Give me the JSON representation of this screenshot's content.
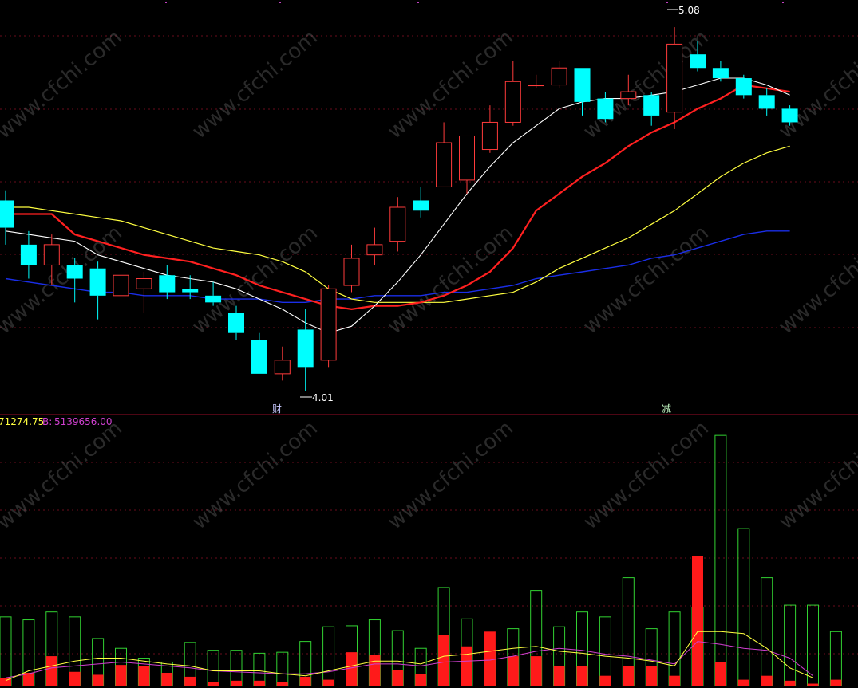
{
  "chart_data": [
    {
      "type": "candlestick",
      "panel": "price",
      "grid": true,
      "colors": {
        "up": "#ff3b3b",
        "down": "#00ffff",
        "ma5": "#ffffff",
        "ma10": "#ff2020",
        "ma20": "#ffff40",
        "ma60": "#1a2ee8",
        "bg": "#000000",
        "grid": "#6a0b1d"
      },
      "candles": [
        {
          "o": 4.57,
          "h": 4.6,
          "l": 4.44,
          "c": 4.49
        },
        {
          "o": 4.44,
          "h": 4.48,
          "l": 4.34,
          "c": 4.38
        },
        {
          "o": 4.38,
          "h": 4.47,
          "l": 4.32,
          "c": 4.44
        },
        {
          "o": 4.38,
          "h": 4.4,
          "l": 4.27,
          "c": 4.34
        },
        {
          "o": 4.37,
          "h": 4.39,
          "l": 4.22,
          "c": 4.29
        },
        {
          "o": 4.29,
          "h": 4.37,
          "l": 4.25,
          "c": 4.35
        },
        {
          "o": 4.31,
          "h": 4.36,
          "l": 4.24,
          "c": 4.34
        },
        {
          "o": 4.35,
          "h": 4.38,
          "l": 4.28,
          "c": 4.3
        },
        {
          "o": 4.31,
          "h": 4.35,
          "l": 4.28,
          "c": 4.3
        },
        {
          "o": 4.29,
          "h": 4.33,
          "l": 4.26,
          "c": 4.27
        },
        {
          "o": 4.24,
          "h": 4.26,
          "l": 4.16,
          "c": 4.18
        },
        {
          "o": 4.16,
          "h": 4.18,
          "l": 4.06,
          "c": 4.06
        },
        {
          "o": 4.06,
          "h": 4.14,
          "l": 4.04,
          "c": 4.1
        },
        {
          "o": 4.19,
          "h": 4.25,
          "l": 4.01,
          "c": 4.08
        },
        {
          "o": 4.1,
          "h": 4.32,
          "l": 4.08,
          "c": 4.31
        },
        {
          "o": 4.32,
          "h": 4.44,
          "l": 4.3,
          "c": 4.4
        },
        {
          "o": 4.41,
          "h": 4.49,
          "l": 4.38,
          "c": 4.44
        },
        {
          "o": 4.45,
          "h": 4.58,
          "l": 4.42,
          "c": 4.55
        },
        {
          "o": 4.57,
          "h": 4.61,
          "l": 4.52,
          "c": 4.54
        },
        {
          "o": 4.61,
          "h": 4.8,
          "l": 4.61,
          "c": 4.74
        },
        {
          "o": 4.63,
          "h": 4.76,
          "l": 4.59,
          "c": 4.76
        },
        {
          "o": 4.72,
          "h": 4.85,
          "l": 4.71,
          "c": 4.8
        },
        {
          "o": 4.8,
          "h": 4.98,
          "l": 4.79,
          "c": 4.92
        },
        {
          "o": 4.91,
          "h": 4.94,
          "l": 4.9,
          "c": 4.91
        },
        {
          "o": 4.91,
          "h": 4.98,
          "l": 4.9,
          "c": 4.96
        },
        {
          "o": 4.96,
          "h": 4.96,
          "l": 4.82,
          "c": 4.86
        },
        {
          "o": 4.87,
          "h": 4.89,
          "l": 4.8,
          "c": 4.81
        },
        {
          "o": 4.87,
          "h": 4.94,
          "l": 4.85,
          "c": 4.89
        },
        {
          "o": 4.88,
          "h": 4.89,
          "l": 4.79,
          "c": 4.82
        },
        {
          "o": 4.83,
          "h": 5.08,
          "l": 4.78,
          "c": 5.03
        },
        {
          "o": 5.0,
          "h": 5.04,
          "l": 4.95,
          "c": 4.96
        },
        {
          "o": 4.96,
          "h": 4.98,
          "l": 4.92,
          "c": 4.93
        },
        {
          "o": 4.93,
          "h": 4.94,
          "l": 4.87,
          "c": 4.88
        },
        {
          "o": 4.88,
          "h": 4.9,
          "l": 4.82,
          "c": 4.84
        },
        {
          "o": 4.84,
          "h": 4.85,
          "l": 4.79,
          "c": 4.8
        }
      ],
      "ma5": [
        4.48,
        4.47,
        4.46,
        4.45,
        4.41,
        4.39,
        4.37,
        4.35,
        4.34,
        4.33,
        4.31,
        4.28,
        4.25,
        4.21,
        4.18,
        4.2,
        4.26,
        4.33,
        4.41,
        4.5,
        4.59,
        4.67,
        4.74,
        4.79,
        4.84,
        4.86,
        4.87,
        4.87,
        4.88,
        4.89,
        4.91,
        4.93,
        4.93,
        4.91,
        4.88
      ],
      "ma10": [
        4.53,
        4.53,
        4.53,
        4.47,
        4.45,
        4.43,
        4.41,
        4.4,
        4.39,
        4.37,
        4.35,
        4.32,
        4.3,
        4.28,
        4.26,
        4.25,
        4.26,
        4.26,
        4.27,
        4.29,
        4.32,
        4.36,
        4.43,
        4.54,
        4.59,
        4.64,
        4.68,
        4.73,
        4.77,
        4.8,
        4.84,
        4.87,
        4.91,
        4.9,
        4.89
      ],
      "ma20": [
        4.55,
        4.55,
        4.54,
        4.53,
        4.52,
        4.51,
        4.49,
        4.47,
        4.45,
        4.43,
        4.42,
        4.41,
        4.39,
        4.36,
        4.31,
        4.28,
        4.27,
        4.27,
        4.27,
        4.27,
        4.28,
        4.29,
        4.3,
        4.33,
        4.37,
        4.4,
        4.43,
        4.46,
        4.5,
        4.54,
        4.59,
        4.64,
        4.68,
        4.71,
        4.73
      ],
      "ma60": [
        4.34,
        4.33,
        4.32,
        4.31,
        4.3,
        4.3,
        4.29,
        4.29,
        4.29,
        4.28,
        4.28,
        4.28,
        4.27,
        4.27,
        4.28,
        4.28,
        4.29,
        4.29,
        4.29,
        4.3,
        4.3,
        4.31,
        4.32,
        4.34,
        4.35,
        4.36,
        4.37,
        4.38,
        4.4,
        4.41,
        4.43,
        4.45,
        4.47,
        4.48,
        4.48
      ],
      "annotations": {
        "high_label": "5.08",
        "low_label": "4.01",
        "event_marks": [
          "财",
          "减"
        ]
      },
      "ylim": [
        3.94,
        5.16
      ]
    },
    {
      "type": "bar",
      "panel": "volume",
      "grid": true,
      "header_text": "71274.75",
      "header_b_label": "B:",
      "header_b_value": "5139656.00",
      "colors": {
        "total_outline": "#32d232",
        "b_fill": "#ff1a1a",
        "line_a": "#ffff40",
        "line_b": "#d040d0",
        "header_a": "#ffff40",
        "header_b": "#d040d0"
      },
      "total": [
        70,
        67,
        75,
        70,
        48,
        38,
        28,
        24,
        44,
        36,
        36,
        33,
        34,
        45,
        60,
        61,
        67,
        56,
        38,
        100,
        68,
        36,
        58,
        97,
        60,
        75,
        70,
        110,
        58,
        75,
        80,
        255,
        160,
        110,
        82,
        82,
        55
      ],
      "buy": [
        8,
        13,
        30,
        14,
        11,
        21,
        20,
        13,
        9,
        4,
        5,
        5,
        4,
        9,
        6,
        34,
        31,
        16,
        12,
        52,
        40,
        55,
        30,
        30,
        20,
        20,
        10,
        20,
        20,
        10,
        132,
        24,
        6,
        10,
        5,
        2,
        6
      ],
      "line_a": [
        5,
        15,
        20,
        25,
        28,
        28,
        25,
        22,
        20,
        15,
        15,
        15,
        12,
        10,
        15,
        20,
        25,
        25,
        22,
        30,
        32,
        35,
        38,
        40,
        35,
        33,
        30,
        28,
        25,
        20,
        55,
        55,
        53,
        38,
        18,
        8
      ],
      "line_b": [
        8,
        12,
        18,
        20,
        22,
        24,
        22,
        20,
        18,
        15,
        14,
        13,
        12,
        12,
        14,
        18,
        22,
        22,
        20,
        24,
        25,
        26,
        30,
        35,
        38,
        36,
        32,
        30,
        26,
        22,
        45,
        42,
        38,
        36,
        28,
        10
      ],
      "ylim": [
        0,
        260
      ]
    }
  ],
  "watermark": "www.cfchi.com"
}
